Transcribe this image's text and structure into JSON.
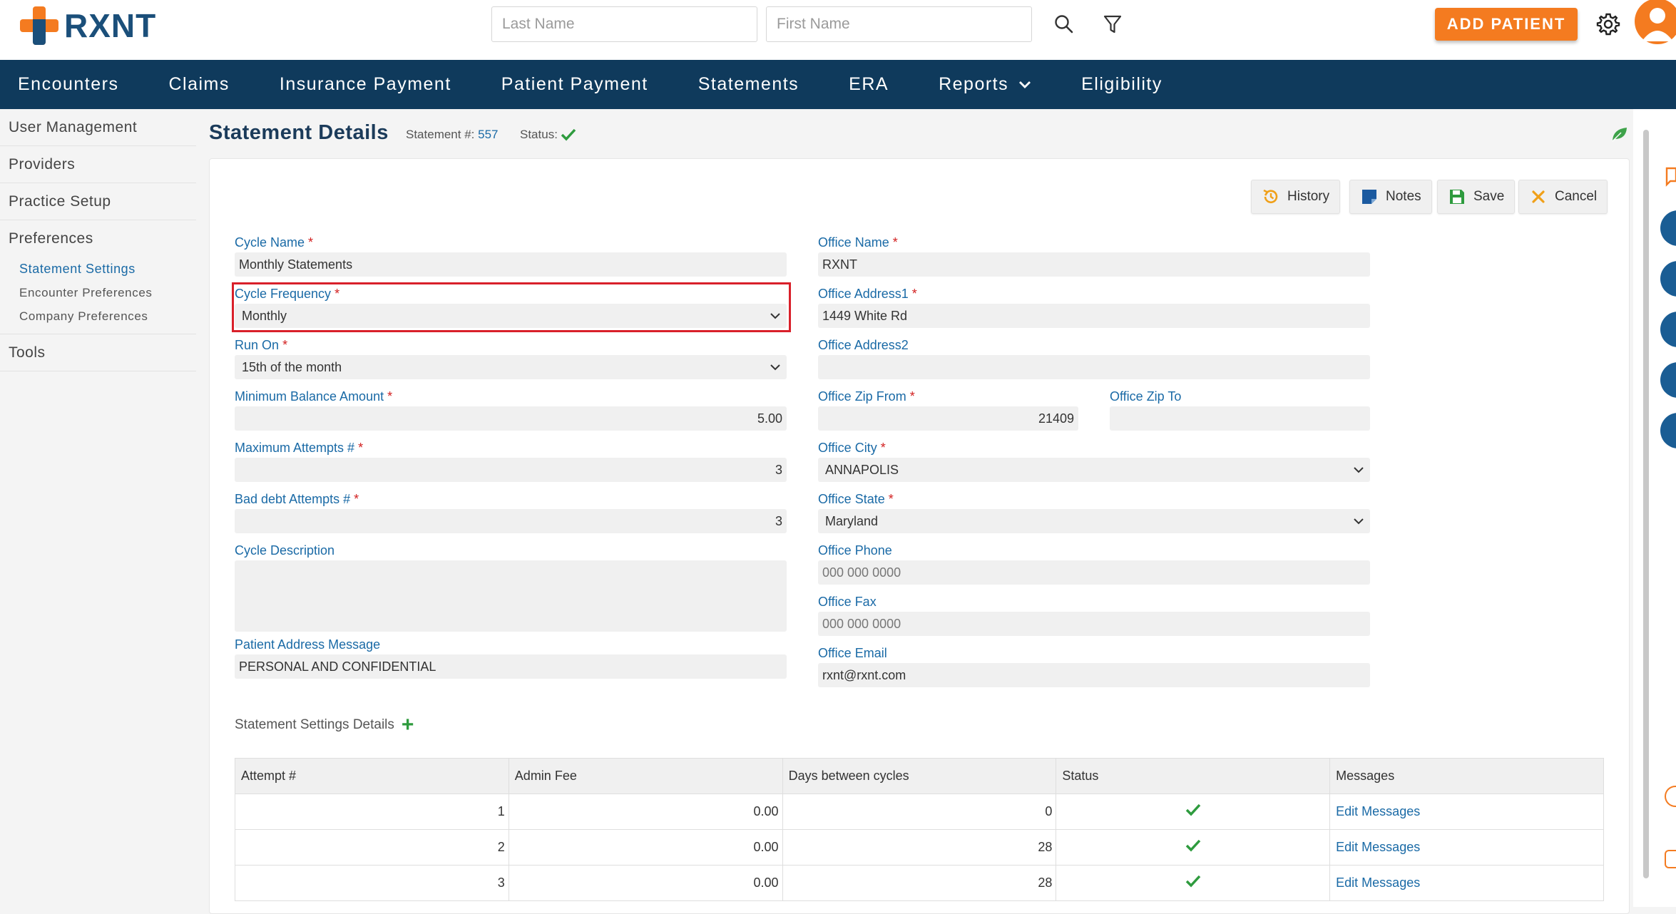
{
  "app": {
    "logo_text": "RXNT"
  },
  "header": {
    "last_name_placeholder": "Last Name",
    "first_name_placeholder": "First Name",
    "add_patient_label": "ADD PATIENT"
  },
  "nav": {
    "items": [
      "Encounters",
      "Claims",
      "Insurance Payment",
      "Patient Payment",
      "Statements",
      "ERA",
      "Reports",
      "Eligibility"
    ]
  },
  "sidebar": {
    "items": [
      "User Management",
      "Providers",
      "Practice Setup",
      "Preferences",
      "Tools"
    ],
    "sub_items": [
      "Statement Settings",
      "Encounter Preferences",
      "Company Preferences"
    ]
  },
  "page": {
    "title": "Statement Details",
    "statement_label": "Statement #:",
    "statement_number": "557",
    "status_label": "Status:"
  },
  "toolbar": {
    "history": "History",
    "notes": "Notes",
    "save": "Save",
    "cancel": "Cancel"
  },
  "form": {
    "cycle_name": {
      "label": "Cycle Name",
      "value": "Monthly Statements"
    },
    "cycle_frequency": {
      "label": "Cycle Frequency",
      "value": "Monthly"
    },
    "run_on": {
      "label": "Run On",
      "value": "15th of the month"
    },
    "minimum_balance": {
      "label": "Minimum Balance Amount",
      "value": "5.00"
    },
    "maximum_attempts": {
      "label": "Maximum Attempts #",
      "value": "3"
    },
    "bad_debt_attempts": {
      "label": "Bad debt Attempts #",
      "value": "3"
    },
    "cycle_description": {
      "label": "Cycle Description",
      "value": ""
    },
    "patient_address_message": {
      "label": "Patient Address Message",
      "value": "PERSONAL AND CONFIDENTIAL"
    },
    "office_name": {
      "label": "Office Name",
      "value": "RXNT"
    },
    "office_address1": {
      "label": "Office Address1",
      "value": "1449 White Rd"
    },
    "office_address2": {
      "label": "Office Address2",
      "value": ""
    },
    "office_zip_from": {
      "label": "Office Zip From",
      "value": "21409"
    },
    "office_zip_to": {
      "label": "Office Zip To",
      "value": ""
    },
    "office_city": {
      "label": "Office City",
      "value": "ANNAPOLIS"
    },
    "office_state": {
      "label": "Office State",
      "value": "Maryland"
    },
    "office_phone": {
      "label": "Office Phone",
      "placeholder": "000 000 0000"
    },
    "office_fax": {
      "label": "Office Fax",
      "placeholder": "000 000 0000"
    },
    "office_email": {
      "label": "Office Email",
      "value": "rxnt@rxnt.com"
    }
  },
  "details": {
    "title": "Statement Settings Details",
    "columns": [
      "Attempt #",
      "Admin Fee",
      "Days between cycles",
      "Status",
      "Messages"
    ],
    "rows": [
      {
        "attempt": "1",
        "admin_fee": "0.00",
        "days": "0",
        "message_link": "Edit Messages"
      },
      {
        "attempt": "2",
        "admin_fee": "0.00",
        "days": "28",
        "message_link": "Edit Messages"
      },
      {
        "attempt": "3",
        "admin_fee": "0.00",
        "days": "28",
        "message_link": "Edit Messages"
      }
    ]
  },
  "colors": {
    "brand_navy": "#0f3a5c",
    "brand_orange": "#f47b20",
    "link_blue": "#1a6aa6",
    "success_green": "#2e9b3e",
    "required_red": "#d21f1f"
  },
  "icons": [
    "search-icon",
    "filter-icon",
    "gear-icon",
    "avatar-icon",
    "chevron-down-icon",
    "check-icon",
    "history-icon",
    "notes-icon",
    "save-icon",
    "cancel-icon",
    "leaf-icon",
    "plus-icon"
  ]
}
